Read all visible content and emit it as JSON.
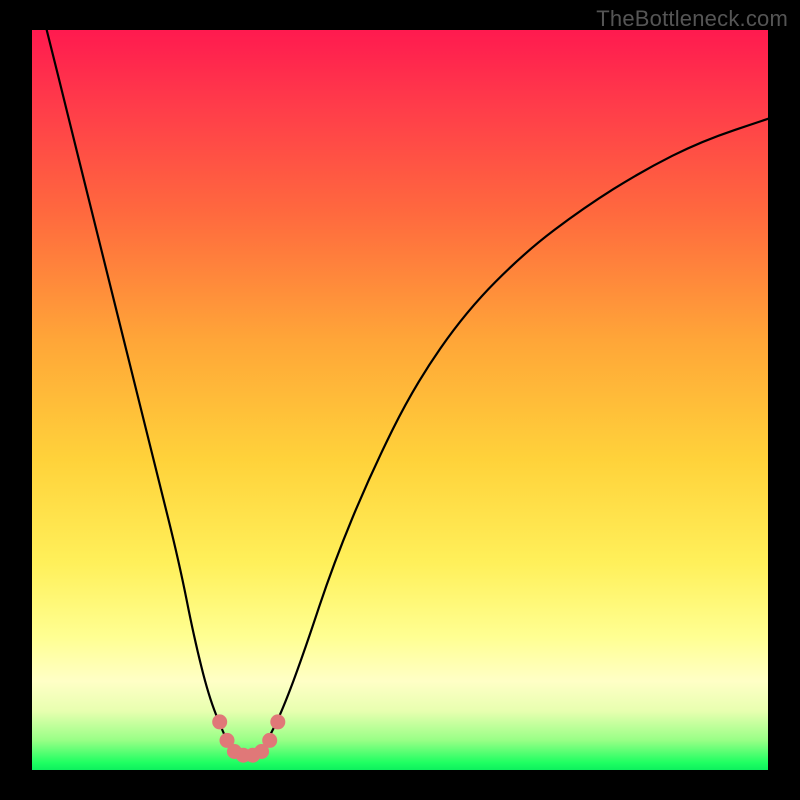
{
  "watermark": "TheBottleneck.com",
  "chart_data": {
    "type": "line",
    "title": "",
    "xlabel": "",
    "ylabel": "",
    "xlim": [
      0,
      100
    ],
    "ylim": [
      0,
      100
    ],
    "series": [
      {
        "name": "bottleneck-curve",
        "x": [
          2,
          5,
          8,
          11,
          14,
          17,
          20,
          22,
          24,
          26,
          27,
          28,
          29,
          30,
          31,
          32,
          34,
          37,
          41,
          46,
          52,
          59,
          67,
          75,
          83,
          91,
          100
        ],
        "values": [
          100,
          88,
          76,
          64,
          52,
          40,
          28,
          18,
          10,
          5,
          3,
          2,
          2,
          2,
          2.5,
          4,
          8,
          16,
          28,
          40,
          52,
          62,
          70,
          76,
          81,
          85,
          88
        ]
      }
    ],
    "markers": {
      "name": "bottom-dots",
      "color": "#e07878",
      "points": [
        {
          "x": 25.5,
          "y": 6.5
        },
        {
          "x": 26.5,
          "y": 4.0
        },
        {
          "x": 27.5,
          "y": 2.5
        },
        {
          "x": 28.7,
          "y": 2.0
        },
        {
          "x": 30.0,
          "y": 2.0
        },
        {
          "x": 31.2,
          "y": 2.5
        },
        {
          "x": 32.3,
          "y": 4.0
        },
        {
          "x": 33.4,
          "y": 6.5
        }
      ]
    }
  }
}
